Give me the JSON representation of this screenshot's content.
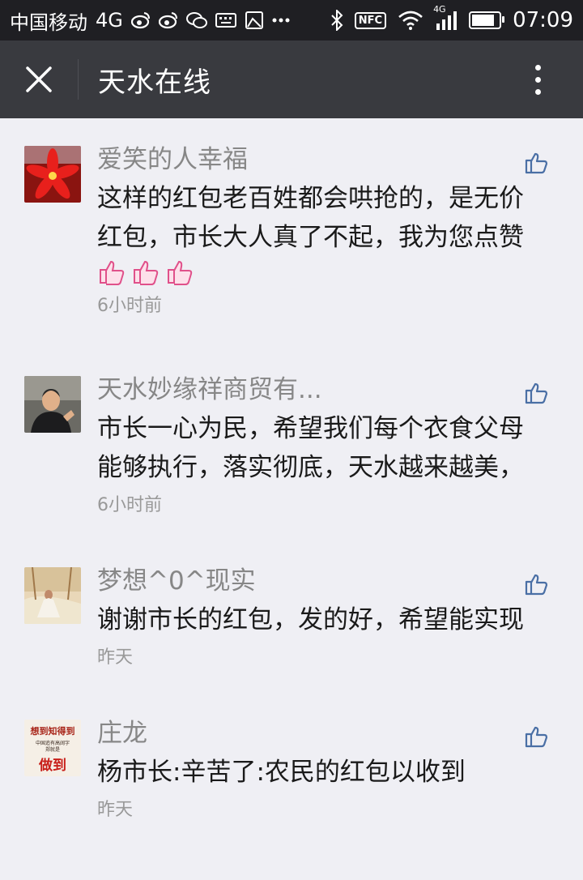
{
  "status_bar": {
    "carrier": "中国移动",
    "network": "4G",
    "time": "07:09",
    "nfc_label": "NFC",
    "signal_label": "4G",
    "battery_level": 0.85
  },
  "header": {
    "title": "天水在线"
  },
  "comments": [
    {
      "name": "爱笑的人幸福",
      "text_line1": "这样的红包老百姓都会哄抢的，是无价",
      "text_line2": "红包，市长大人真了不起，我为您点赞",
      "time": "6小时前"
    },
    {
      "name": "天水妙缘祥商贸有...",
      "text_line1": "市长一心为民，希望我们每个衣食父母",
      "text_line2": "能够执行，落实彻底，天水越来越美，",
      "time": "6小时前"
    },
    {
      "name": "梦想^0^现实",
      "text_line1": "谢谢市长的红包，发的好，希望能实现",
      "time": "昨天"
    },
    {
      "name": "庄龙",
      "text_line1": "杨市长:辛苦了:农民的红包以收到",
      "time": "昨天"
    }
  ],
  "avatar4": {
    "line1": "想到知得到",
    "line2": "中国追有高阔字",
    "line3": "郑就是",
    "line4": "做到"
  },
  "colors": {
    "statusbar_bg": "#1f1f23",
    "navbar_bg": "#393a3f",
    "page_bg": "#efeff4",
    "like_icon": "#4a6fa5",
    "thumb_emoji": "#e0508a"
  }
}
